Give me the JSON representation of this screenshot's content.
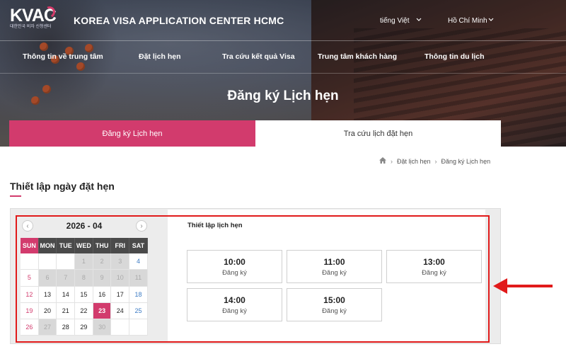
{
  "header": {
    "logo_text": "KVAC",
    "logo_sub": "대한민국 비자 신청센터",
    "brand_title": "KOREA VISA APPLICATION CENTER HCMC",
    "language": "tiếng Việt",
    "city": "Hồ Chí Minh"
  },
  "nav": {
    "items": [
      "Thông tin về trung tâm",
      "Đặt lịch hẹn",
      "Tra cứu kết quả Visa",
      "Trung tâm khách hàng",
      "Thông tin du lịch"
    ]
  },
  "page": {
    "title": "Đăng ký Lịch hẹn"
  },
  "tabs": {
    "active": "Đăng ký Lịch hẹn",
    "inactive": "Tra cứu lịch đặt hẹn"
  },
  "breadcrumb": {
    "items": [
      "Đặt lịch hẹn",
      "Đăng ký Lịch hẹn"
    ]
  },
  "section": {
    "title": "Thiết lập ngày đặt hẹn"
  },
  "calendar": {
    "month_label": "2026 - 04",
    "weekdays": [
      "SUN",
      "MON",
      "TUE",
      "WED",
      "THU",
      "FRI",
      "SAT"
    ],
    "weeks": [
      [
        "",
        "",
        "",
        "1",
        "2",
        "3",
        "4"
      ],
      [
        "5",
        "6",
        "7",
        "8",
        "9",
        "10",
        "11"
      ],
      [
        "12",
        "13",
        "14",
        "15",
        "16",
        "17",
        "18"
      ],
      [
        "19",
        "20",
        "21",
        "22",
        "23",
        "24",
        "25"
      ],
      [
        "26",
        "27",
        "28",
        "29",
        "30",
        "",
        ""
      ]
    ],
    "selected_day": "23"
  },
  "slots": {
    "title": "Thiết lập lịch hẹn",
    "items": [
      {
        "time": "10:00",
        "label": "Đăng ký"
      },
      {
        "time": "11:00",
        "label": "Đăng ký"
      },
      {
        "time": "13:00",
        "label": "Đăng ký"
      },
      {
        "time": "14:00",
        "label": "Đăng ký"
      },
      {
        "time": "15:00",
        "label": "Đăng ký"
      }
    ]
  },
  "colors": {
    "accent": "#d23b6d",
    "highlight": "#e11a1a"
  }
}
